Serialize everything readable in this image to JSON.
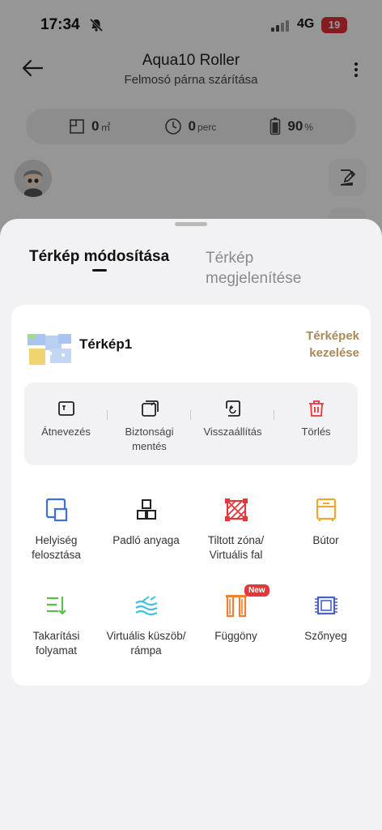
{
  "status": {
    "time": "17:34",
    "network": "4G",
    "battery": "19"
  },
  "header": {
    "title": "Aqua10 Roller",
    "subtitle": "Felmosó párna szárítása"
  },
  "stats": [
    {
      "icon": "area-icon",
      "value": "0",
      "unit": "㎡"
    },
    {
      "icon": "clock-icon",
      "value": "0",
      "unit": "perc"
    },
    {
      "icon": "battery-icon",
      "value": "90",
      "unit": "%"
    }
  ],
  "sheet": {
    "tabs": [
      {
        "label": "Térkép módosítása",
        "active": true
      },
      {
        "label": "Térkép megjelenítése",
        "active": false
      }
    ],
    "map": {
      "name": "Térkép1",
      "manage_label": "Térképek kezelése"
    },
    "actions": [
      {
        "label": "Átnevezés",
        "icon": "rename-icon"
      },
      {
        "label": "Biztonsági mentés",
        "icon": "backup-icon"
      },
      {
        "label": "Visszaállítás",
        "icon": "restore-icon"
      },
      {
        "label": "Törlés",
        "icon": "trash-icon"
      }
    ],
    "tools": [
      {
        "label": "Helyiség felosztása",
        "icon": "room-split-icon",
        "color": "#3d6fe0"
      },
      {
        "label": "Padló anyaga",
        "icon": "floor-material-icon",
        "color": "#222222"
      },
      {
        "label": "Tiltott zóna/ Virtuális fal",
        "icon": "no-go-zone-icon",
        "color": "#e8343b"
      },
      {
        "label": "Bútor",
        "icon": "furniture-icon",
        "color": "#f0a830"
      },
      {
        "label": "Takarítási folyamat",
        "icon": "cleaning-sequence-icon",
        "color": "#5cbf4a"
      },
      {
        "label": "Virtuális küszöb/ rámpa",
        "icon": "threshold-icon",
        "color": "#3ec3e0"
      },
      {
        "label": "Függöny",
        "icon": "curtain-icon",
        "color": "#f08030",
        "badge": "New"
      },
      {
        "label": "Szőnyeg",
        "icon": "carpet-icon",
        "color": "#4a5fc8"
      }
    ]
  }
}
